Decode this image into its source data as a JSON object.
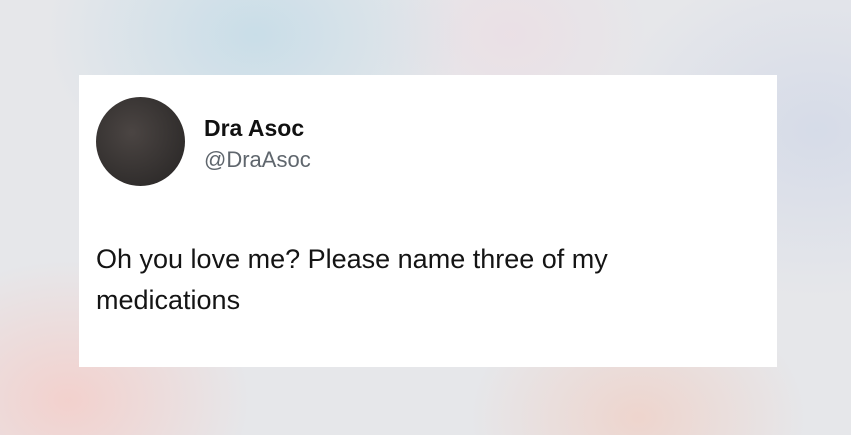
{
  "post": {
    "author": {
      "display_name": "Dra Asoc",
      "handle": "@DraAsoc",
      "avatar_color": "#3a3533"
    },
    "text": "Oh you love me? Please name three of my medications"
  }
}
